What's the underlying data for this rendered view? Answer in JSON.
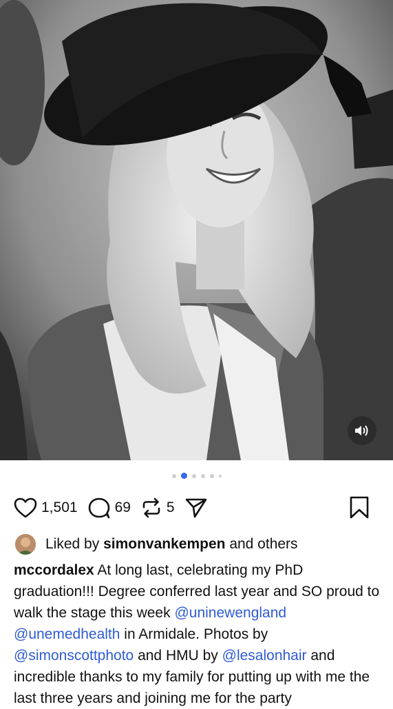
{
  "post": {
    "media_alt": "Black and white photo of a smiling woman in graduation cap and gown",
    "carousel": {
      "count": 6,
      "active_index": 1
    },
    "sound_icon": "speaker-icon"
  },
  "actions": {
    "likes_count": "1,501",
    "comments_count": "69",
    "reposts_count": "5",
    "icons": [
      "heart-icon",
      "comment-icon",
      "repost-icon",
      "send-icon",
      "bookmark-icon"
    ]
  },
  "liked_by": {
    "prefix": "Liked by",
    "user": "simonvankempen",
    "suffix": "and others"
  },
  "caption": {
    "username": "mccordalex",
    "text_1": "At long last, celebrating my PhD graduation!!! Degree conferred last year and SO proud to walk the stage this week",
    "mention_1": "@uninewengland",
    "mention_2": "@unemedhealth",
    "text_2": "in Armidale. Photos by",
    "mention_3": "@simonscottphoto",
    "text_3": "and HMU by",
    "mention_4": "@lesalonhair",
    "text_4": "and incredible thanks to my family for putting up with me the last three years and joining me for the party"
  },
  "colors": {
    "accent": "#3a66e8",
    "mention": "#2f5bd3",
    "text": "#111111"
  }
}
